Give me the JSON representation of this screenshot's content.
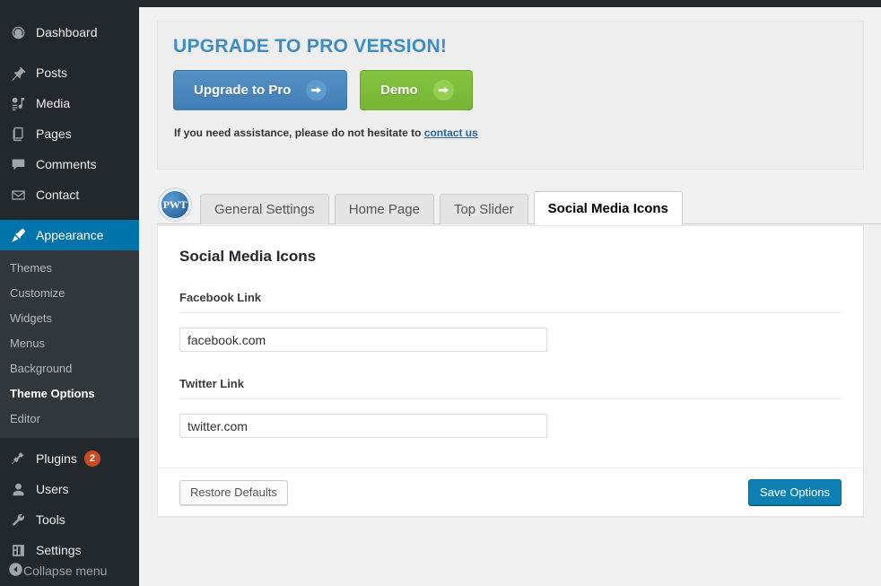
{
  "sidebar": {
    "items": [
      {
        "label": "Dashboard",
        "icon": "dashboard-icon",
        "name": "dashboard"
      },
      {
        "label": "Posts",
        "icon": "pin-icon",
        "name": "posts"
      },
      {
        "label": "Media",
        "icon": "media-icon",
        "name": "media"
      },
      {
        "label": "Pages",
        "icon": "pages-icon",
        "name": "pages"
      },
      {
        "label": "Comments",
        "icon": "comment-icon",
        "name": "comments"
      },
      {
        "label": "Contact",
        "icon": "envelope-icon",
        "name": "contact"
      },
      {
        "label": "Appearance",
        "icon": "brush-icon",
        "name": "appearance"
      },
      {
        "label": "Plugins",
        "icon": "plug-icon",
        "name": "plugins",
        "badge": "2"
      },
      {
        "label": "Users",
        "icon": "user-icon",
        "name": "users"
      },
      {
        "label": "Tools",
        "icon": "wrench-icon",
        "name": "tools"
      },
      {
        "label": "Settings",
        "icon": "settings-icon",
        "name": "settings"
      }
    ],
    "current_item": "Appearance",
    "submenu": [
      {
        "label": "Themes",
        "active": false
      },
      {
        "label": "Customize",
        "active": false
      },
      {
        "label": "Widgets",
        "active": false
      },
      {
        "label": "Menus",
        "active": false
      },
      {
        "label": "Background",
        "active": false
      },
      {
        "label": "Theme Options",
        "active": true
      },
      {
        "label": "Editor",
        "active": false
      }
    ],
    "collapse_label": "Collapse menu",
    "collapse_icon": "collapse-arrow-icon",
    "accent_color": "#0073aa",
    "badge_color": "#ca4a1f",
    "background_color": "#23282d",
    "submenu_background_color": "#32373c"
  },
  "promo": {
    "title": "UPGRADE TO PRO VERSION!",
    "upgrade_button": "Upgrade to Pro",
    "demo_button": "Demo",
    "arrow_icon": "arrow-right-icon",
    "note_text": "If you need assistance, please do not hesitate to",
    "note_link": "contact us",
    "title_color": "#3c8dc5",
    "upgrade_color": "#417eb5",
    "demo_color": "#76b534"
  },
  "tabs": {
    "logo_text": "PWT",
    "items": [
      {
        "label": "General Settings",
        "active": false
      },
      {
        "label": "Home Page",
        "active": false
      },
      {
        "label": "Top Slider",
        "active": false
      },
      {
        "label": "Social Media Icons",
        "active": true
      }
    ]
  },
  "panel": {
    "title": "Social Media Icons",
    "fields": [
      {
        "label": "Facebook Link",
        "value": "facebook.com",
        "placeholder": "facebook.com",
        "name": "facebook-link"
      },
      {
        "label": "Twitter Link",
        "value": "twitter.com",
        "placeholder": "twitter.com",
        "name": "twitter-link"
      }
    ],
    "restore_button": "Restore Defaults",
    "save_button": "Save Options",
    "save_color": "#0e7fb2"
  }
}
